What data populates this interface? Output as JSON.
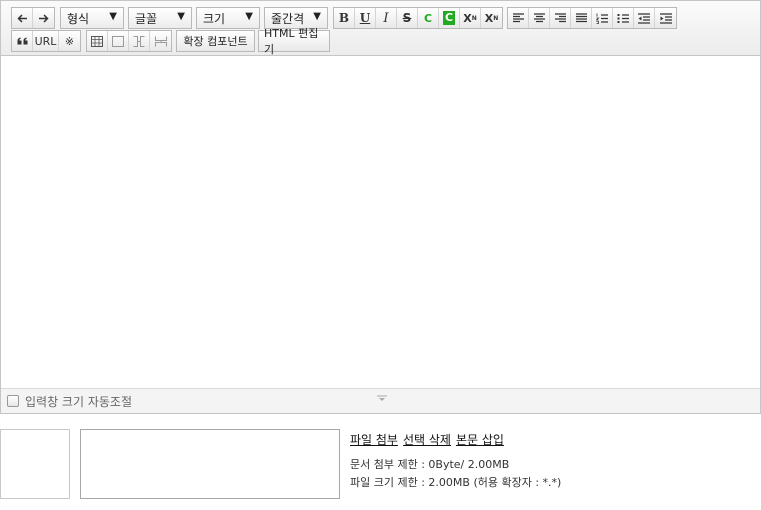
{
  "toolbar": {
    "format_select": "형식",
    "font_select": "글꼴",
    "size_select": "크기",
    "line_height_select": "줄간격",
    "url_label": "URL",
    "special_char_label": "※",
    "quote_label": "66",
    "bold_label": "B",
    "underline_label": "U",
    "italic_label": "I",
    "strike_label": "S",
    "font_color_label": "C",
    "bg_color_label": "C",
    "superscript_label": "X",
    "subscript_label": "X",
    "extension_component_label": "확장 컴포넌트",
    "html_editor_label": "HTML 편집기"
  },
  "resize": {
    "label": "입력창 크기 자동조절"
  },
  "attachment": {
    "attach_label": "파일 첨부",
    "delete_label": "선택 삭제",
    "insert_label": "본문 삽입",
    "doc_limit": "문서 첨부 제한 : 0Byte/ 2.00MB",
    "file_limit": "파일 크기 제한 : 2.00MB (허용 확장자 : *.*)"
  },
  "colors": {
    "font_color": "#22aa22",
    "bg_color": "#22aa22"
  }
}
